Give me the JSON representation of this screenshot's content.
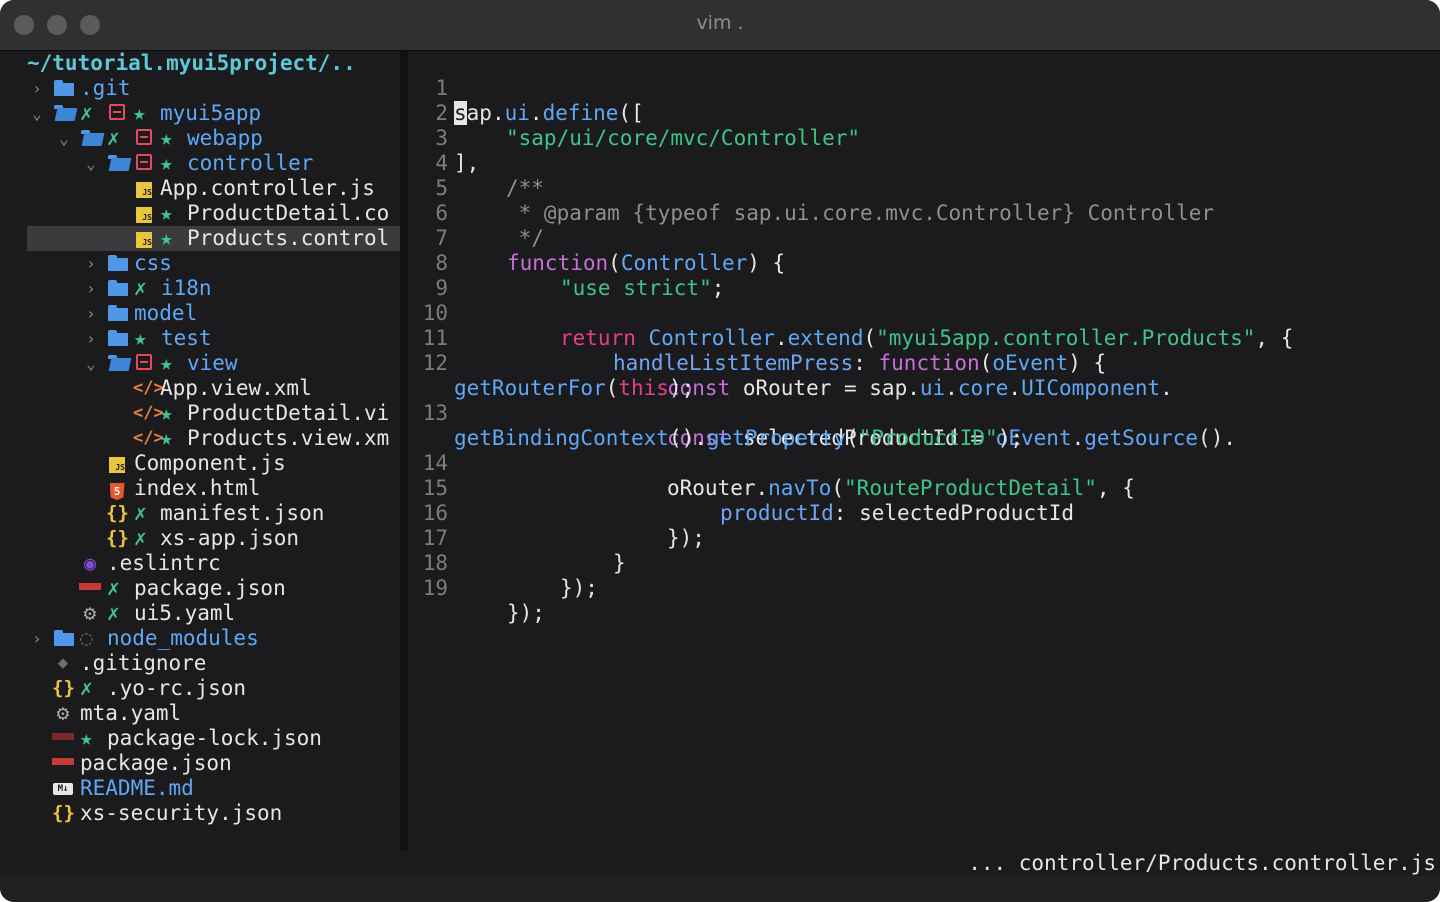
{
  "window": {
    "title": "vim ."
  },
  "tree": {
    "root_path": "~/tutorial.myui5project/..",
    "items": [
      {
        "name": ".git"
      },
      {
        "name": "myui5app"
      },
      {
        "name": "webapp"
      },
      {
        "name": "controller"
      },
      {
        "name": "App.controller.js"
      },
      {
        "name": "ProductDetail.co"
      },
      {
        "name": "Products.control"
      },
      {
        "name": "css"
      },
      {
        "name": "i18n"
      },
      {
        "name": "model"
      },
      {
        "name": "test"
      },
      {
        "name": "view"
      },
      {
        "name": "App.view.xml"
      },
      {
        "name": "ProductDetail.vi"
      },
      {
        "name": "Products.view.xm"
      },
      {
        "name": "Component.js"
      },
      {
        "name": "index.html"
      },
      {
        "name": "manifest.json"
      },
      {
        "name": "xs-app.json"
      },
      {
        "name": ".eslintrc"
      },
      {
        "name": "package.json"
      },
      {
        "name": "ui5.yaml"
      },
      {
        "name": "node_modules"
      },
      {
        "name": ".gitignore"
      },
      {
        "name": ".yo-rc.json"
      },
      {
        "name": "mta.yaml"
      },
      {
        "name": "package-lock.json"
      },
      {
        "name": "package.json"
      },
      {
        "name": "README.md"
      },
      {
        "name": "xs-security.json"
      }
    ],
    "git_untracked_glyph": "✗",
    "git_added_glyph": "★",
    "icons": [
      "folder-icon",
      "folder-open-icon",
      "js-file-icon",
      "xml-file-icon",
      "json-file-icon",
      "html-file-icon",
      "npm-icon",
      "gear-icon",
      "eslint-icon",
      "git-icon",
      "markdown-icon",
      "modified-icon"
    ]
  },
  "editor": {
    "lines": [
      {
        "n": "1"
      },
      {
        "n": "2"
      },
      {
        "n": "3"
      },
      {
        "n": "4"
      },
      {
        "n": "5"
      },
      {
        "n": "6"
      },
      {
        "n": "7"
      },
      {
        "n": "8"
      },
      {
        "n": "9"
      },
      {
        "n": "10"
      },
      {
        "n": "11"
      },
      {
        "n": "12"
      },
      {
        "n": "13"
      },
      {
        "n": "14"
      },
      {
        "n": "15"
      },
      {
        "n": "16"
      },
      {
        "n": "17"
      },
      {
        "n": "18"
      },
      {
        "n": "19"
      }
    ],
    "t": {
      "l1_cursor": "s",
      "l1_a": "ap",
      "l1_b": ".",
      "l1_c": "ui",
      "l1_d": ".",
      "l1_e": "define",
      "l1_f": "([",
      "l2_str": "\"sap/ui/core/mvc/Controller\"",
      "l3": "],",
      "l4": "/**",
      "l5": " * @param {typeof sap.ui.core.mvc.Controller} Controller",
      "l6": " */",
      "l7_fn": "function",
      "l7_a": "(",
      "l7_arg": "Controller",
      "l7_b": ") {",
      "l8_str": "\"use strict\"",
      "l8_end": ";",
      "l10_ret": "return ",
      "l10_cls": "Controller",
      "l10_dot": ".",
      "l10_ext": "extend",
      "l10_p": "(",
      "l10_str": "\"myui5app.controller.Products\"",
      "l10_end": ", {",
      "l11_key": "handleListItemPress",
      "l11_colon": ": ",
      "l11_fn": "function",
      "l11_p": "(",
      "l11_arg": "oEvent",
      "l11_end": ") {",
      "l12_const": "const ",
      "l12_var": "oRouter = sap.",
      "l12_ui": "ui",
      "l12_d1": ".",
      "l12_core": "core",
      "l12_d2": ".",
      "l12_comp": "UIComponent",
      "l12_end": ".",
      "l12w_fn": "getRouterFor",
      "l12w_p": "(",
      "l12w_this": "this",
      "l12w_end": ");",
      "l13_const": "const ",
      "l13_var": "selectedProductId = ",
      "l13_ev": "oEvent",
      "l13_d": ".",
      "l13_gs": "getSource",
      "l13_end": "().",
      "l13w_gbc": "getBindingContext",
      "l13w_a": "().",
      "l13w_gp": "getProperty",
      "l13w_p": "(",
      "l13w_str": "\"ProductID\"",
      "l13w_end": ");",
      "l14_var": "oRouter.",
      "l14_nav": "navTo",
      "l14_p": "(",
      "l14_str": "\"RouteProductDetail\"",
      "l14_end": ", {",
      "l15_key": "productId",
      "l15_rest": ": selectedProductId",
      "l16": "});",
      "l17": "}",
      "l18": "});",
      "l19": "});"
    }
  },
  "statusline": {
    "path": "... controller/Products.controller.js"
  }
}
